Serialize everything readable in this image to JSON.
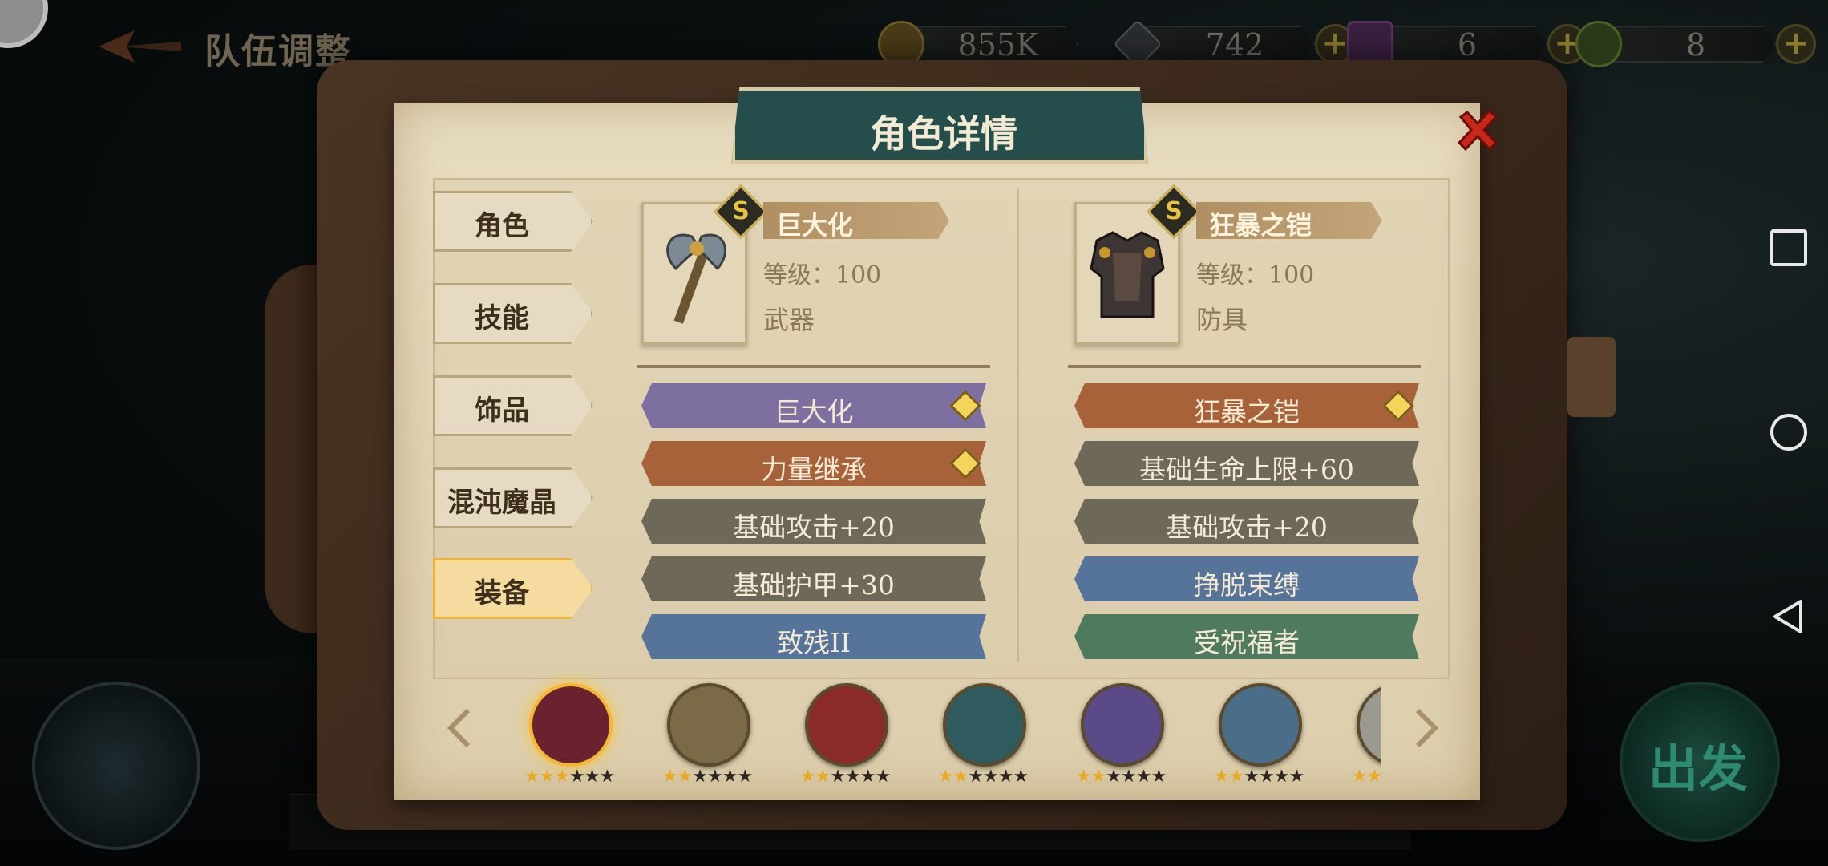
{
  "header": {
    "title": "队伍调整",
    "resources": [
      {
        "icon": "gold-coin-icon",
        "value": "855K"
      },
      {
        "icon": "diamond-icon",
        "value": "742"
      },
      {
        "icon": "purple-ticket-icon",
        "value": "6"
      },
      {
        "icon": "green-rune-icon",
        "value": "8"
      }
    ]
  },
  "modal": {
    "title": "角色详情",
    "tabs": [
      {
        "label": "角色"
      },
      {
        "label": "技能"
      },
      {
        "label": "饰品"
      },
      {
        "label": "混沌魔晶"
      },
      {
        "label": "装备",
        "active": true
      }
    ],
    "equipment": [
      {
        "icon": "axe-weapon-icon",
        "name": "巨大化",
        "level": "等级：100",
        "type": "武器",
        "skills": [
          {
            "label": "巨大化",
            "color": "#7d6fa0",
            "gem": true
          },
          {
            "label": "力量继承",
            "color": "#a8623a",
            "gem": true
          },
          {
            "label": "基础攻击+20",
            "color": "#6e6858"
          },
          {
            "label": "基础护甲+30",
            "color": "#6e6858"
          },
          {
            "label": "致残II",
            "color": "#56739a"
          }
        ]
      },
      {
        "icon": "armor-chest-icon",
        "name": "狂暴之铠",
        "level": "等级：100",
        "type": "防具",
        "skills": [
          {
            "label": "狂暴之铠",
            "color": "#a8623a",
            "gem": true
          },
          {
            "label": "基础生命上限+60",
            "color": "#6e6858"
          },
          {
            "label": "基础攻击+20",
            "color": "#6e6858"
          },
          {
            "label": "挣脱束缚",
            "color": "#56739a"
          },
          {
            "label": "受祝福者",
            "color": "#4f7a5e"
          }
        ]
      }
    ],
    "heroes": [
      {
        "name": "hero-1",
        "stars": 3,
        "selected": true,
        "color": "#6a2230"
      },
      {
        "name": "hero-2",
        "stars": 2,
        "color": "#7a6a48"
      },
      {
        "name": "hero-3",
        "stars": 2,
        "color": "#8a2a2a"
      },
      {
        "name": "hero-4",
        "stars": 2,
        "color": "#2f5a5e"
      },
      {
        "name": "hero-5",
        "stars": 2,
        "color": "#5a4a88"
      },
      {
        "name": "hero-6",
        "stars": 2,
        "color": "#4a6e88"
      },
      {
        "name": "hero-7",
        "stars": 2,
        "color": "#9a9a90"
      }
    ]
  },
  "go_button": {
    "label": "出发"
  },
  "colors": {
    "accent_gold": "#f3b733",
    "title_teal": "#244d4c",
    "close_red": "#c8281c"
  }
}
